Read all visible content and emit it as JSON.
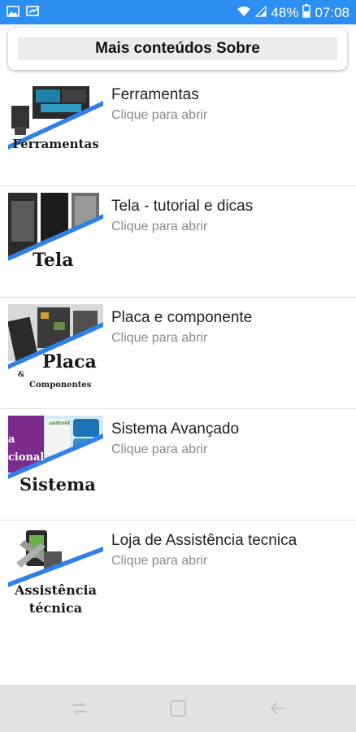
{
  "status_bar": {
    "battery": "48%",
    "time": "07:08"
  },
  "header": {
    "title": "Mais conteúdos Sobre"
  },
  "items": [
    {
      "title": "Ferramentas",
      "subtitle": "Clique para abrir",
      "thumb_label": "Ferramentas"
    },
    {
      "title": "Tela - tutorial e dicas",
      "subtitle": "Clique para abrir",
      "thumb_label": "Tela"
    },
    {
      "title": "Placa e componente",
      "subtitle": "Clique para abrir",
      "thumb_label": "Placa",
      "thumb_label2": "Componentes",
      "thumb_amp": "&"
    },
    {
      "title": "Sistema Avançado",
      "subtitle": "Clique para abrir",
      "thumb_label": "Sistema",
      "thumb_text_a": "a",
      "thumb_text_b": "cional",
      "thumb_text_c": "android"
    },
    {
      "title": "Loja de Assistência tecnica",
      "subtitle": "Clique para abrir",
      "thumb_label": "Assistência",
      "thumb_label2": "técnica"
    }
  ],
  "nav": {
    "icons": [
      "recent-apps-icon",
      "home-icon",
      "back-icon"
    ]
  },
  "colors": {
    "status_bar": "#2b8ef0",
    "accent_stripe": "#2f80e8",
    "nav_bar": "#e2e2e2"
  }
}
